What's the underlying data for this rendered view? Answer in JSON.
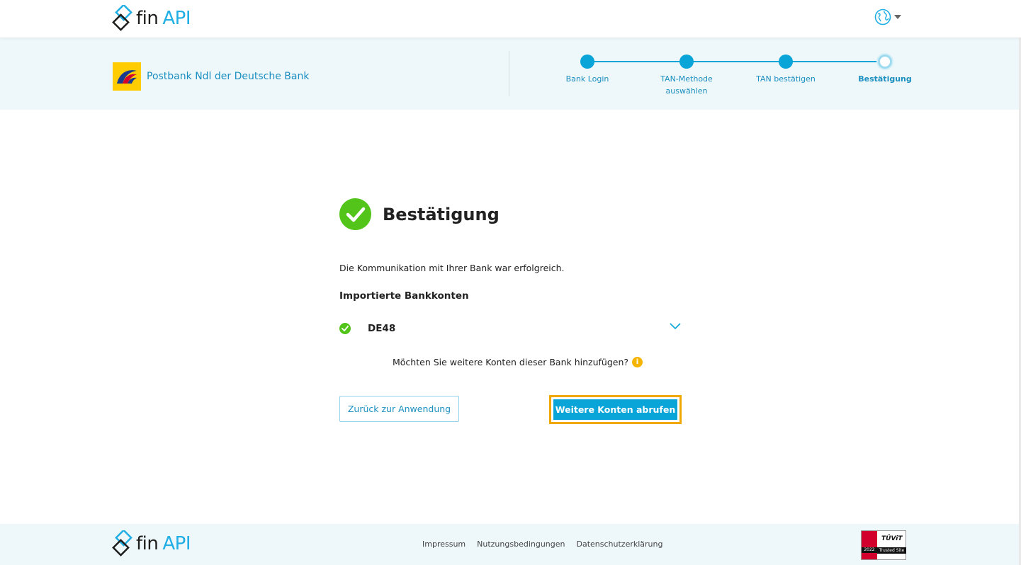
{
  "header": {
    "logo_fin": "fin",
    "logo_api": "API"
  },
  "bank": {
    "name": "Postbank Ndl der Deutsche Bank"
  },
  "stepper": {
    "steps": [
      {
        "label": "Bank Login"
      },
      {
        "label": "TAN-Methode auswählen"
      },
      {
        "label": "TAN bestätigen"
      },
      {
        "label": "Bestätigung"
      }
    ],
    "current_step": 4
  },
  "main": {
    "title": "Bestätigung",
    "success_message": "Die Kommunikation mit Ihrer Bank war erfolgreich.",
    "imported_heading": "Importierte Bankkonten",
    "accounts": [
      {
        "iban": "DE48"
      }
    ],
    "more_question": "Möchten Sie weitere Konten dieser Bank hinzufügen?",
    "info_symbol": "i",
    "back_button": "Zurück zur Anwendung",
    "more_button": "Weitere Konten abrufen"
  },
  "footer": {
    "logo_fin": "fin",
    "logo_api": "API",
    "links": [
      "Impressum",
      "Nutzungsbedingungen",
      "Datenschutzerklärung"
    ],
    "badge": {
      "brand": "TÜViT",
      "label": "Trusted Site",
      "year": "2022"
    }
  },
  "colors": {
    "accent": "#0aa5d8",
    "success": "#52c41a",
    "focus_outline": "#f0a800",
    "band_background": "#eef7fa",
    "bank_logo": "#fecc00"
  },
  "icons": [
    "finapi-logo-icon",
    "globe-icon",
    "caret-down-icon",
    "postbank-logo-icon",
    "check-circle-icon",
    "chevron-down-icon",
    "info-icon"
  ]
}
